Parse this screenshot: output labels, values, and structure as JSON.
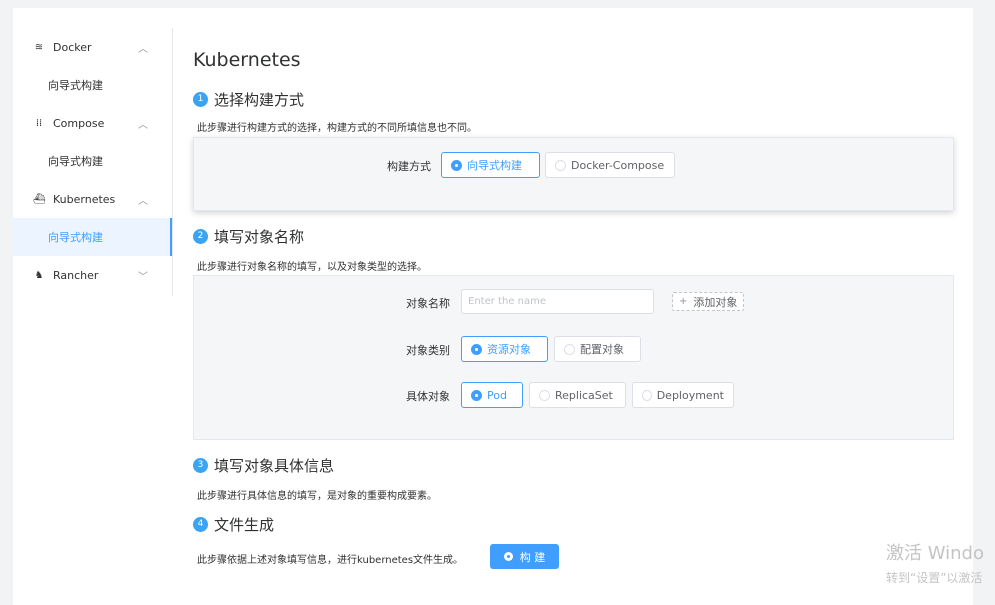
{
  "sidebar": {
    "groups": [
      {
        "label": "Docker",
        "icon": "layers-icon",
        "item": "向导式构建"
      },
      {
        "label": "Compose",
        "icon": "grid-icon",
        "item": "向导式构建"
      },
      {
        "label": "Kubernetes",
        "icon": "ship-icon",
        "item": "向导式构建"
      },
      {
        "label": "Rancher",
        "icon": "rancher-icon"
      }
    ]
  },
  "main": {
    "title": "Kubernetes",
    "steps": [
      {
        "num": "1",
        "title": "选择构建方式",
        "desc": "此步骤进行构建方式的选择，构建方式的不同所填信息也不同。"
      },
      {
        "num": "2",
        "title": "填写对象名称",
        "desc": "此步骤进行对象名称的填写，以及对象类型的选择。"
      },
      {
        "num": "3",
        "title": "填写对象具体信息",
        "desc": "此步骤进行具体信息的填写，是对象的重要构成要素。"
      },
      {
        "num": "4",
        "title": "文件生成",
        "desc": "此步骤依据上述对象填写信息，进行kubernetes文件生成。"
      }
    ],
    "build_mode": {
      "label": "构建方式",
      "options": [
        "向导式构建",
        "Docker-Compose"
      ],
      "selected": "向导式构建"
    },
    "object_name": {
      "label": "对象名称",
      "placeholder": "Enter the name",
      "value": "",
      "add_label": "添加对象"
    },
    "object_category": {
      "label": "对象类别",
      "options": [
        "资源对象",
        "配置对象"
      ],
      "selected": "资源对象"
    },
    "object_kind": {
      "label": "具体对象",
      "options": [
        "Pod",
        "ReplicaSet",
        "Deployment"
      ],
      "selected": "Pod"
    },
    "build_button": "构 建"
  },
  "watermark": {
    "line1": "激活 Windo",
    "line2": "转到“设置”以激活"
  },
  "colors": {
    "accent": "#409eff",
    "step_badge": "#3aa3f4",
    "active_menu_bg": "#ecf5ff"
  }
}
